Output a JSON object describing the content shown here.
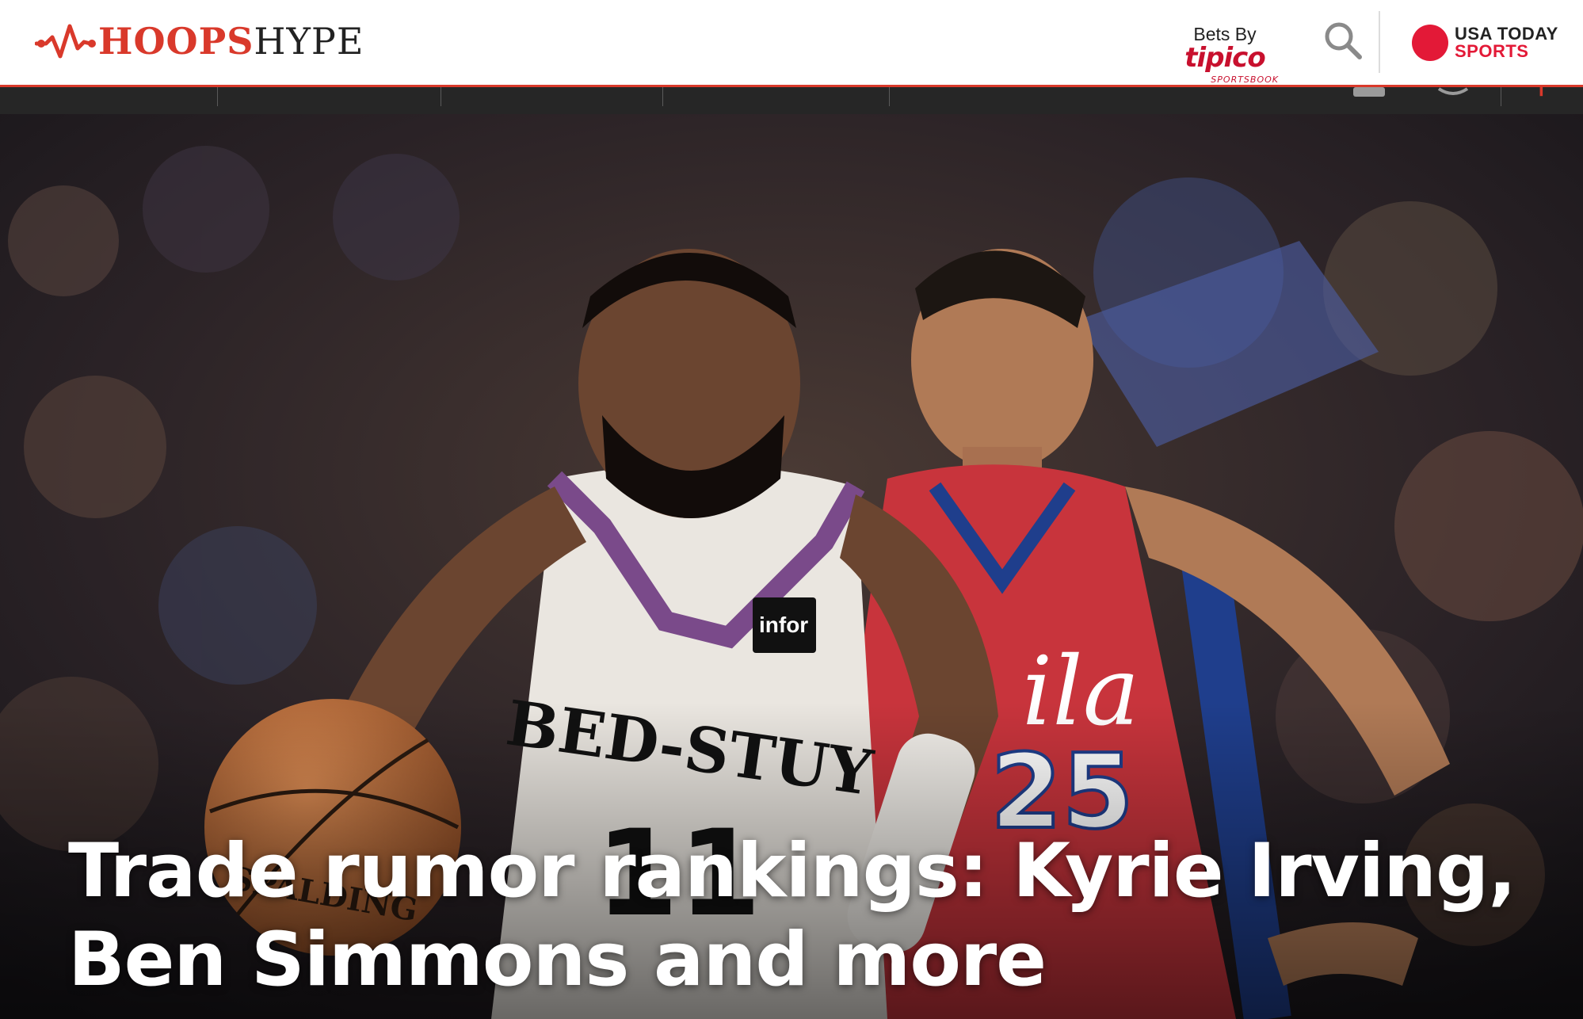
{
  "header": {
    "logo": {
      "part1": "HOOPS",
      "part2": "HYPE"
    },
    "bets": {
      "label": "Bets By",
      "brand": "tipico",
      "brand_sub": "SPORTSBOOK"
    },
    "search_icon": "search-icon",
    "partner": {
      "line1": "USA TODAY",
      "line2": "SPORTS"
    }
  },
  "colors": {
    "brand_red": "#d9392b",
    "tipico_red": "#c8102e",
    "usat_red": "#e31937",
    "text_dark": "#222222",
    "subnav_bg": "#262626"
  },
  "article": {
    "headline": "Trade rumor rankings: Kyrie Irving, Ben Simmons and more"
  }
}
